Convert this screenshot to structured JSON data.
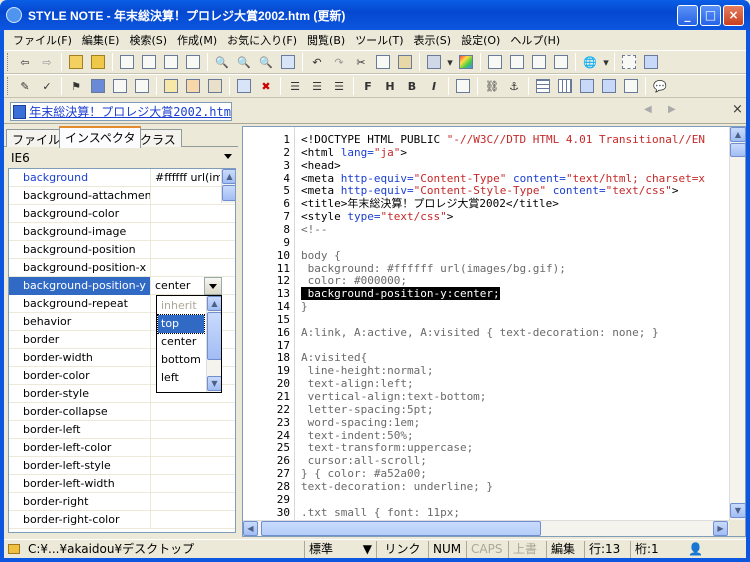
{
  "window": {
    "title": "STYLE NOTE - 年末総決算！プロレジ大賞2002.htm (更新)",
    "buttons": {
      "minimize": "_",
      "maximize": "□",
      "close": "×"
    }
  },
  "menu": [
    "ファイル(F)",
    "編集(E)",
    "検索(S)",
    "作成(M)",
    "お気に入り(F)",
    "閲覧(B)",
    "ツール(T)",
    "表示(S)",
    "設定(O)",
    "ヘルプ(H)"
  ],
  "toolbar1": [
    "back-icon",
    "forward-icon",
    "open-folder-icon",
    "open-icon",
    "new-icon",
    "copy-doc-icon",
    "copy-doc2-icon",
    "find-icon",
    "find-prev-icon",
    "find-next-icon",
    "replace-icon",
    "undo-icon",
    "redo-icon",
    "cut-icon",
    "copy-icon",
    "paste-icon",
    "preview-icon",
    "color-icon",
    "view1-icon",
    "view2-icon",
    "view3-icon",
    "view4-icon",
    "browser-icon",
    "split1-icon",
    "split2-icon"
  ],
  "toolbar2": [
    "pen-icon",
    "check-icon",
    "stamp-icon",
    "save-icon",
    "bmp-icon",
    "png-icon",
    "img1-icon",
    "img2-icon",
    "img3-icon",
    "line-icon",
    "del-icon",
    "align-left-icon",
    "align-center-icon",
    "align-right-icon",
    "font-icon",
    "heading-icon",
    "bold-icon",
    "italic-icon",
    "image-icon",
    "link-icon",
    "table-icon",
    "table2-icon",
    "table3-icon",
    "table4-icon",
    "table5-icon",
    "help-icon"
  ],
  "document": {
    "tab": "年末総決算！プロレジ大賞2002.htm",
    "nav_prev": "◀",
    "nav_next": "▶",
    "close": "×"
  },
  "left_panel": {
    "tabs": [
      "ファイル",
      "インスペクタ",
      "クラス"
    ],
    "active_tab": "インスペクタ",
    "browser_select": "IE6",
    "properties": [
      {
        "name": "background",
        "value": "#ffffff url(im"
      },
      {
        "name": "background-attachment",
        "value": ""
      },
      {
        "name": "background-color",
        "value": ""
      },
      {
        "name": "background-image",
        "value": ""
      },
      {
        "name": "background-position",
        "value": ""
      },
      {
        "name": "background-position-x",
        "value": ""
      },
      {
        "name": "background-position-y",
        "value": "center"
      },
      {
        "name": "background-repeat",
        "value": ""
      },
      {
        "name": "behavior",
        "value": ""
      },
      {
        "name": "border",
        "value": ""
      },
      {
        "name": "border-width",
        "value": ""
      },
      {
        "name": "border-color",
        "value": ""
      },
      {
        "name": "border-style",
        "value": ""
      },
      {
        "name": "border-collapse",
        "value": ""
      },
      {
        "name": "border-left",
        "value": ""
      },
      {
        "name": "border-left-color",
        "value": ""
      },
      {
        "name": "border-left-style",
        "value": ""
      },
      {
        "name": "border-left-width",
        "value": ""
      },
      {
        "name": "border-right",
        "value": ""
      },
      {
        "name": "border-right-color",
        "value": ""
      }
    ],
    "dropdown_options": [
      "inherit",
      "top",
      "center",
      "bottom",
      "left"
    ]
  },
  "editor": {
    "line_numbers": [
      "1",
      "2",
      "3",
      "4",
      "5",
      "6",
      "7",
      "8",
      "9",
      "10",
      "11",
      "12",
      "13",
      "14",
      "15",
      "16",
      "17",
      "18",
      "19",
      "20",
      "21",
      "22",
      "23",
      "24",
      "25",
      "26",
      "27",
      "28",
      "29",
      "30"
    ],
    "lines": [
      [
        [
          "t",
          "<!DOCTYPE HTML PUBLIC "
        ],
        [
          "s",
          "\"-//W3C//DTD HTML 4.01 Transitional//EN"
        ]
      ],
      [
        [
          "t",
          "<html "
        ],
        [
          "a",
          "lang="
        ],
        [
          "s",
          "\"ja\""
        ],
        [
          "t",
          ">"
        ]
      ],
      [
        [
          "t",
          "<head>"
        ]
      ],
      [
        [
          "t",
          "<meta "
        ],
        [
          "a",
          "http-equiv="
        ],
        [
          "s",
          "\"Content-Type\" "
        ],
        [
          "a",
          "content="
        ],
        [
          "s",
          "\"text/html; charset=x"
        ]
      ],
      [
        [
          "t",
          "<meta "
        ],
        [
          "a",
          "http-equiv="
        ],
        [
          "s",
          "\"Content-Style-Type\" "
        ],
        [
          "a",
          "content="
        ],
        [
          "s",
          "\"text/css\""
        ],
        [
          "t",
          ">"
        ]
      ],
      [
        [
          "t",
          "<title>年末総決算！プロレジ大賞2002</title>"
        ]
      ],
      [
        [
          "t",
          "<style "
        ],
        [
          "a",
          "type="
        ],
        [
          "s",
          "\"text/css\""
        ],
        [
          "t",
          ">"
        ]
      ],
      [
        [
          "g",
          "<!--"
        ]
      ],
      [
        [
          "g",
          ""
        ]
      ],
      [
        [
          "g",
          "body {"
        ]
      ],
      [
        [
          "g",
          " background: #ffffff url(images/bg.gif);"
        ]
      ],
      [
        [
          "g",
          " color: #000000;"
        ]
      ],
      [
        [
          "x",
          " background-position-y:center;"
        ]
      ],
      [
        [
          "g",
          "}"
        ]
      ],
      [
        [
          "g",
          ""
        ]
      ],
      [
        [
          "g",
          "A:link, A:active, A:visited { text-decoration: none; }"
        ]
      ],
      [
        [
          "g",
          ""
        ]
      ],
      [
        [
          "g",
          "A:visited{"
        ]
      ],
      [
        [
          "g",
          " line-height:normal;"
        ]
      ],
      [
        [
          "g",
          " text-align:left;"
        ]
      ],
      [
        [
          "g",
          " vertical-align:text-bottom;"
        ]
      ],
      [
        [
          "g",
          " letter-spacing:5pt;"
        ]
      ],
      [
        [
          "g",
          " word-spacing:1em;"
        ]
      ],
      [
        [
          "g",
          " text-indent:50%;"
        ]
      ],
      [
        [
          "g",
          " text-transform:uppercase;"
        ]
      ],
      [
        [
          "g",
          " cursor:all-scroll;"
        ]
      ],
      [
        [
          "g",
          "} { color: #a52a00;"
        ]
      ],
      [
        [
          "g",
          "text-decoration: underline; }"
        ]
      ],
      [
        [
          "g",
          ""
        ]
      ],
      [
        [
          "g",
          ".txt small { font: 11px;"
        ]
      ]
    ]
  },
  "statusbar": {
    "path": "C:¥...¥akaidou¥デスクトップ",
    "mode": "標準",
    "link": "リンク",
    "num": "NUM",
    "caps": "CAPS",
    "overwrite": "上書",
    "edit": "編集",
    "line": "行:13",
    "col": "桁:1"
  }
}
